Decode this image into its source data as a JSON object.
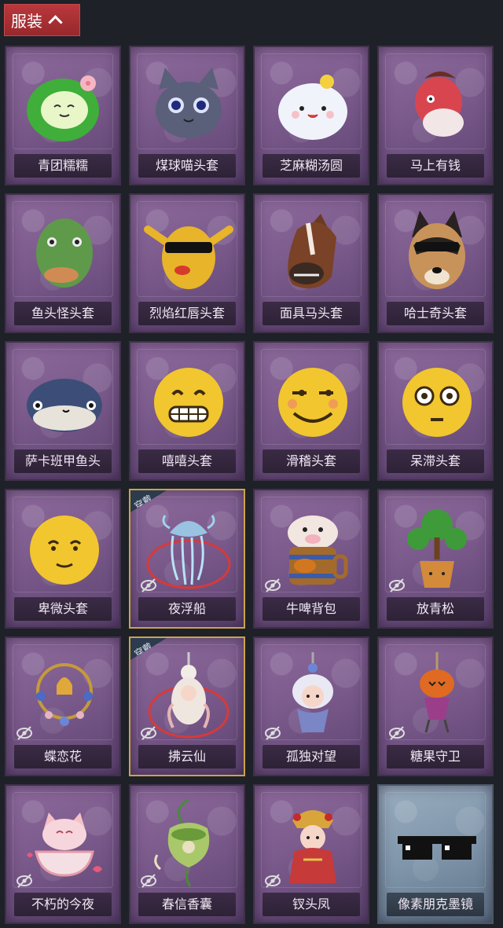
{
  "header": {
    "label": "服装"
  },
  "worn_tag": "穿戴",
  "items": [
    {
      "name": "青团糯糯",
      "art": "green-blob"
    },
    {
      "name": "煤球喵头套",
      "art": "cat"
    },
    {
      "name": "芝麻糊汤圆",
      "art": "white-blob"
    },
    {
      "name": "马上有钱",
      "art": "pink-horse"
    },
    {
      "name": "鱼头怪头套",
      "art": "fish-head"
    },
    {
      "name": "烈焰红唇头套",
      "art": "yellow-mask"
    },
    {
      "name": "面具马头套",
      "art": "horse-mask"
    },
    {
      "name": "哈士奇头套",
      "art": "husky"
    },
    {
      "name": "萨卡班甲鱼头",
      "art": "sacabambaspis"
    },
    {
      "name": "嘻嘻头套",
      "art": "emoji-grin"
    },
    {
      "name": "滑稽头套",
      "art": "emoji-smirk"
    },
    {
      "name": "呆滞头套",
      "art": "emoji-stare"
    },
    {
      "name": "卑微头套",
      "art": "emoji-humble"
    },
    {
      "name": "夜浮船",
      "art": "jellyfish",
      "worn": true,
      "hidden_icon": true
    },
    {
      "name": "牛啤背包",
      "art": "beer-cow",
      "hidden_icon": true
    },
    {
      "name": "放青松",
      "art": "bonsai",
      "hidden_icon": true
    },
    {
      "name": "蝶恋花",
      "art": "bell-charm",
      "hidden_icon": true
    },
    {
      "name": "拂云仙",
      "art": "cloud-doll",
      "worn": true,
      "hidden_icon": true
    },
    {
      "name": "孤独对望",
      "art": "doll-charm",
      "hidden_icon": true
    },
    {
      "name": "糖果守卫",
      "art": "pumpkin-charm",
      "hidden_icon": true
    },
    {
      "name": "不朽的今夜",
      "art": "fox-bowl",
      "hidden_icon": true
    },
    {
      "name": "春信香囊",
      "art": "sachet",
      "hidden_icon": true
    },
    {
      "name": "钗头凤",
      "art": "phoenix-doll",
      "hidden_icon": true
    },
    {
      "name": "像素朋克墨镜",
      "art": "pixel-glasses",
      "blue": true
    }
  ]
}
